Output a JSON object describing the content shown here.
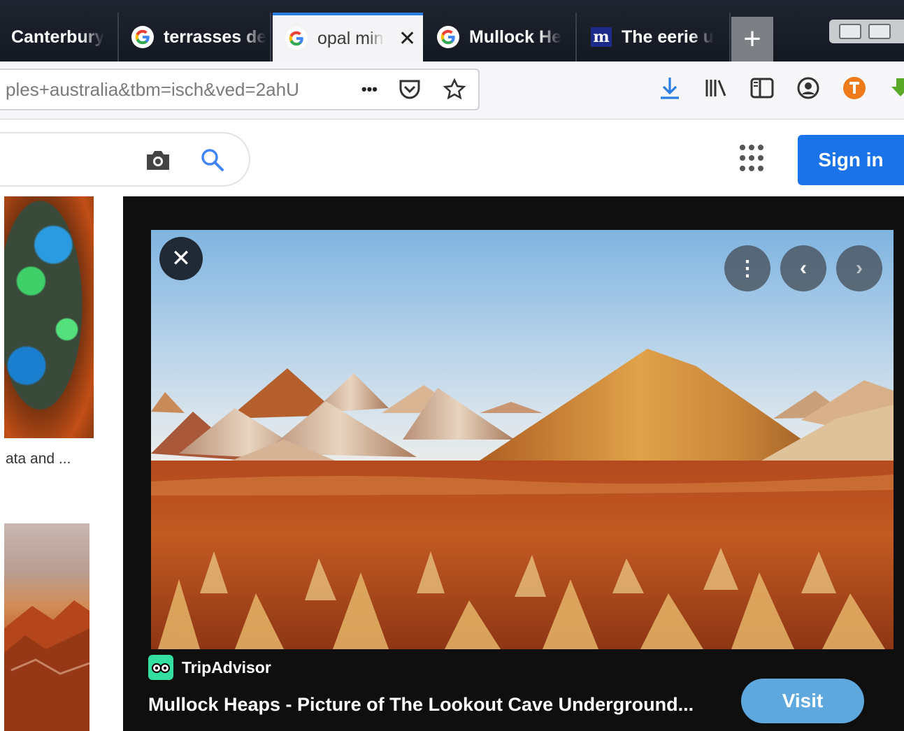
{
  "browser": {
    "tabs": [
      {
        "label": "Canterbury",
        "icon": "none",
        "active": false
      },
      {
        "label": "terrasses de",
        "icon": "google-icon",
        "active": false
      },
      {
        "label": "opal min",
        "icon": "google-icon",
        "active": true
      },
      {
        "label": "Mullock He",
        "icon": "google-icon",
        "active": false
      },
      {
        "label": "The eerie u",
        "icon": "m-icon",
        "active": false
      }
    ],
    "new_tab_symbol": "+",
    "tab_close_symbol": "✕",
    "url_text": "ples+australia&tbm=isch&ved=2ahU",
    "url_more_symbol": "•••",
    "accent_color": "#2a7de1"
  },
  "google": {
    "sign_in_label": "Sign in",
    "sign_in_color": "#1a73e8"
  },
  "results": {
    "left_caption": "ata and ..."
  },
  "preview": {
    "close_symbol": "✕",
    "more_symbol": "⋮",
    "prev_symbol": "‹",
    "next_symbol": "›",
    "source_name": "TripAdvisor",
    "title": "Mullock Heaps - Picture of The Lookout Cave Underground...",
    "visit_label": "Visit",
    "visit_color": "#5ea8de"
  }
}
